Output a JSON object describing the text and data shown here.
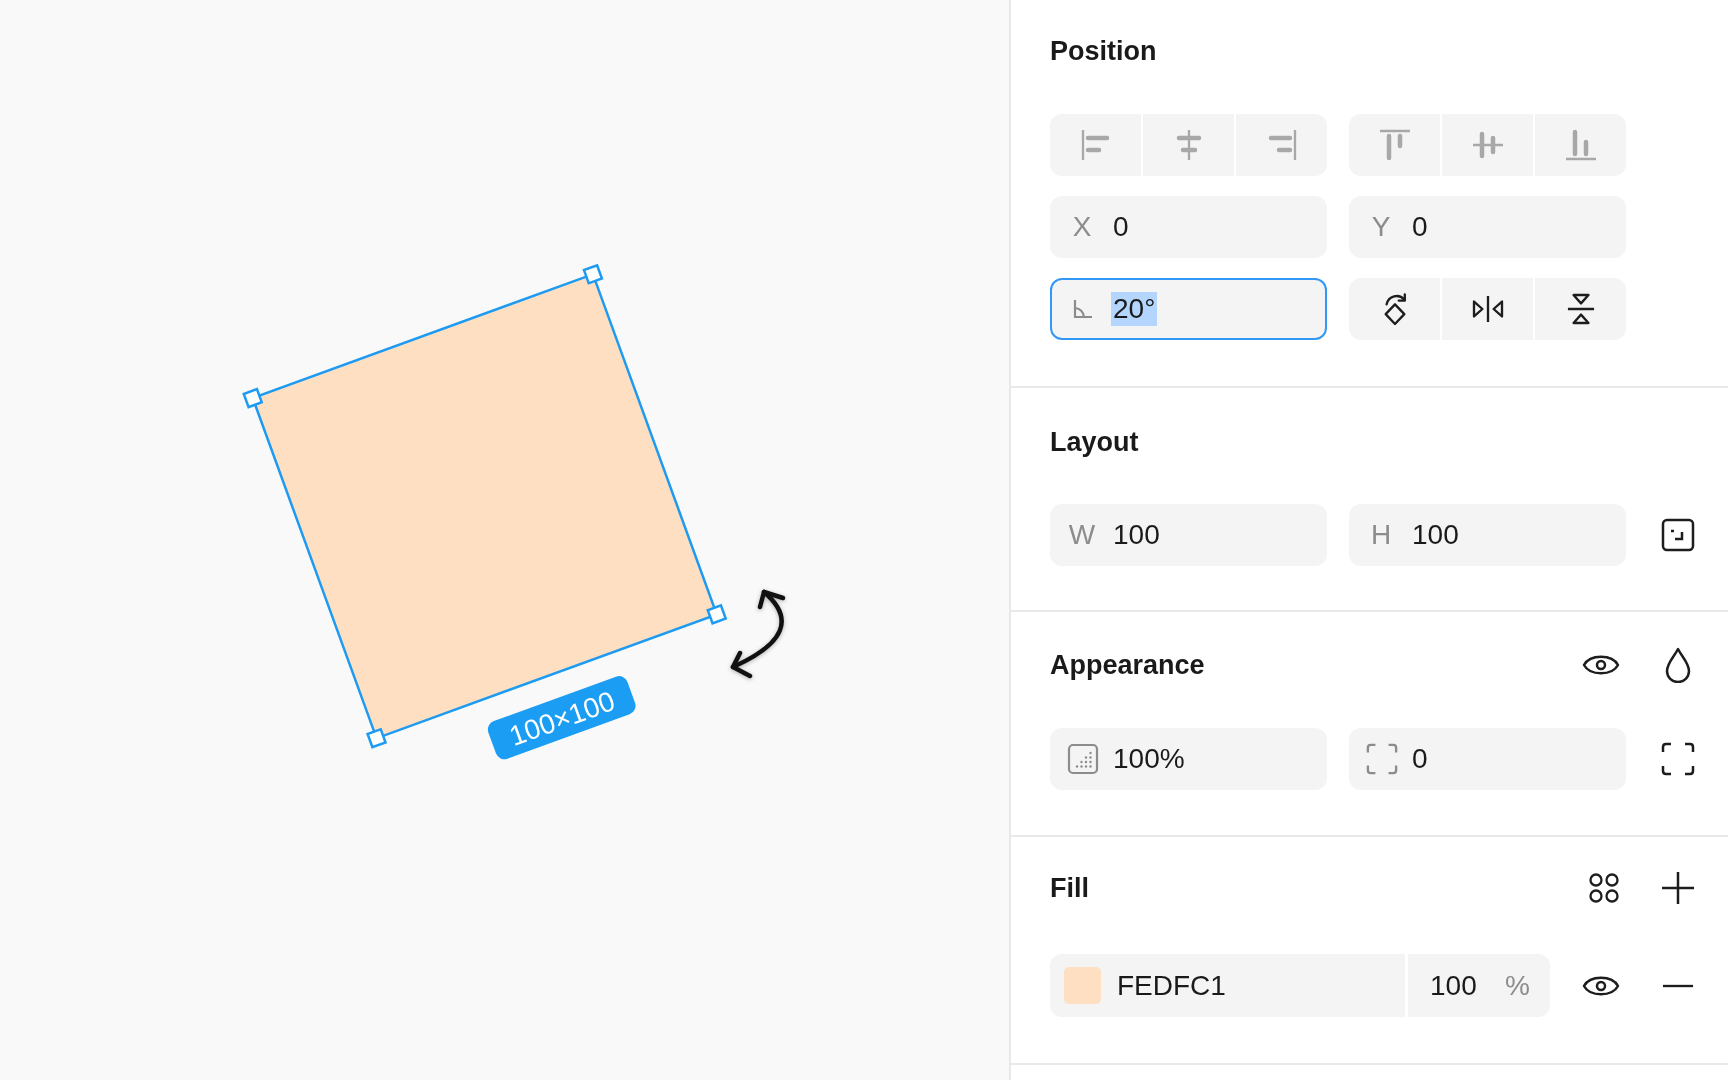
{
  "canvas": {
    "shape": {
      "selected": true,
      "size_label": "100×100"
    }
  },
  "position": {
    "title": "Position",
    "alignment": {
      "disabled": true
    },
    "fields": [
      {
        "label": "X",
        "value": "0"
      },
      {
        "label": "Y",
        "value": "0"
      }
    ],
    "rotation": {
      "value": "20°",
      "focused": true
    }
  },
  "layout": {
    "title": "Layout",
    "fields": [
      {
        "label": "W",
        "value": "100"
      },
      {
        "label": "H",
        "value": "100"
      }
    ]
  },
  "appearance": {
    "title": "Appearance",
    "visible": true,
    "opacity": "100%",
    "corner_radius": "0"
  },
  "fill": {
    "title": "Fill",
    "layers": [
      {
        "color": "#fedfc1",
        "hex": "FEDFC1",
        "opacity": "100",
        "unit": "%",
        "visible": true
      }
    ]
  }
}
